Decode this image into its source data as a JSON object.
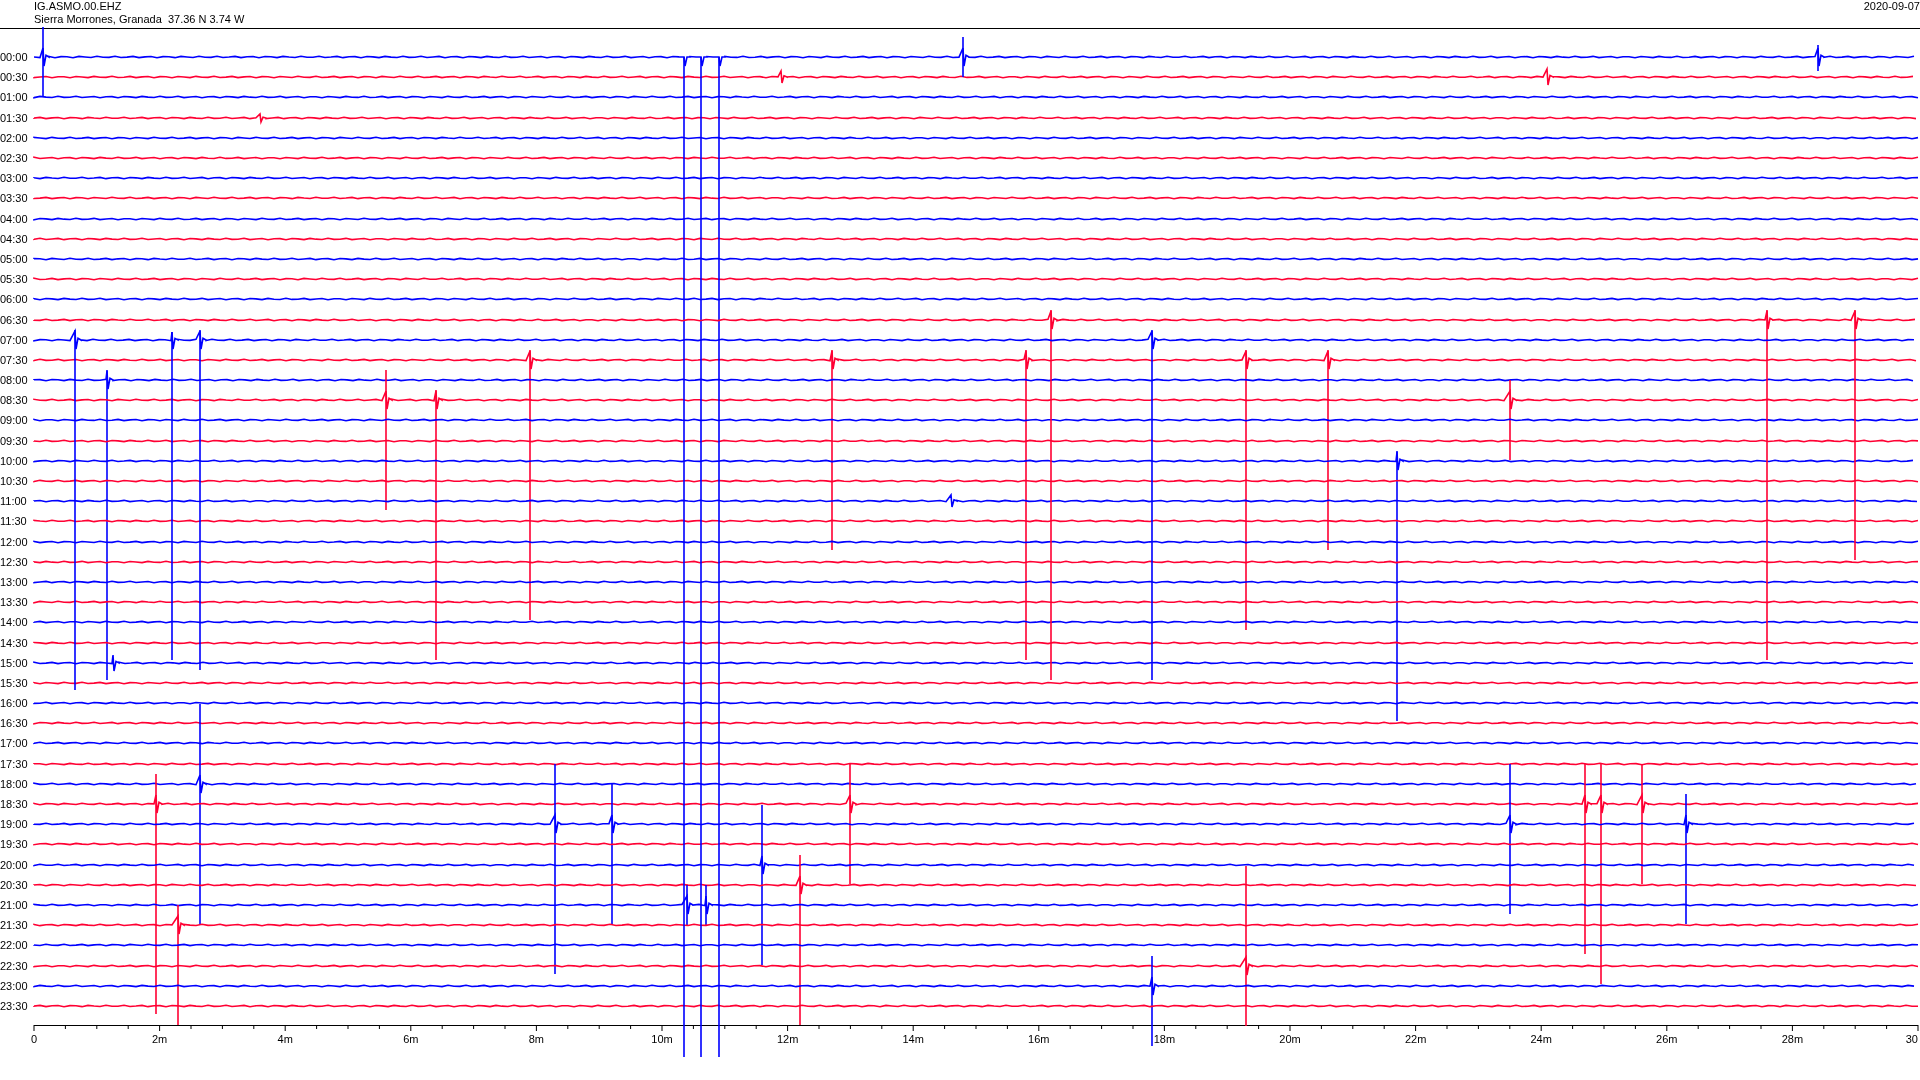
{
  "header": {
    "station": "IG.ASMO.00.EHZ",
    "location": "Sierra Morrones, Granada  37.36 N 3.74 W",
    "date": "2020-09-07"
  },
  "traces": [
    {
      "label": "00:00",
      "color": "#0000ff"
    },
    {
      "label": "00:30",
      "color": "#ff0033"
    },
    {
      "label": "01:00",
      "color": "#0000ff"
    },
    {
      "label": "01:30",
      "color": "#ff0033"
    },
    {
      "label": "02:00",
      "color": "#0000ff"
    },
    {
      "label": "02:30",
      "color": "#ff0033"
    },
    {
      "label": "03:00",
      "color": "#0000ff"
    },
    {
      "label": "03:30",
      "color": "#ff0033"
    },
    {
      "label": "04:00",
      "color": "#0000ff"
    },
    {
      "label": "04:30",
      "color": "#ff0033"
    },
    {
      "label": "05:00",
      "color": "#0000ff"
    },
    {
      "label": "05:30",
      "color": "#ff0033"
    },
    {
      "label": "06:00",
      "color": "#0000ff"
    },
    {
      "label": "06:30",
      "color": "#ff0033"
    },
    {
      "label": "07:00",
      "color": "#0000ff"
    },
    {
      "label": "07:30",
      "color": "#ff0033"
    },
    {
      "label": "08:00",
      "color": "#0000ff"
    },
    {
      "label": "08:30",
      "color": "#ff0033"
    },
    {
      "label": "09:00",
      "color": "#0000ff"
    },
    {
      "label": "09:30",
      "color": "#ff0033"
    },
    {
      "label": "10:00",
      "color": "#0000ff"
    },
    {
      "label": "10:30",
      "color": "#ff0033"
    },
    {
      "label": "11:00",
      "color": "#0000ff"
    },
    {
      "label": "11:30",
      "color": "#ff0033"
    },
    {
      "label": "12:00",
      "color": "#0000ff"
    },
    {
      "label": "12:30",
      "color": "#ff0033"
    },
    {
      "label": "13:00",
      "color": "#0000ff"
    },
    {
      "label": "13:30",
      "color": "#ff0033"
    },
    {
      "label": "14:00",
      "color": "#0000ff"
    },
    {
      "label": "14:30",
      "color": "#ff0033"
    },
    {
      "label": "15:00",
      "color": "#0000ff"
    },
    {
      "label": "15:30",
      "color": "#ff0033"
    },
    {
      "label": "16:00",
      "color": "#0000ff"
    },
    {
      "label": "16:30",
      "color": "#ff0033"
    },
    {
      "label": "17:00",
      "color": "#0000ff"
    },
    {
      "label": "17:30",
      "color": "#ff0033"
    },
    {
      "label": "18:00",
      "color": "#0000ff"
    },
    {
      "label": "18:30",
      "color": "#ff0033"
    },
    {
      "label": "19:00",
      "color": "#0000ff"
    },
    {
      "label": "19:30",
      "color": "#ff0033"
    },
    {
      "label": "20:00",
      "color": "#0000ff"
    },
    {
      "label": "20:30",
      "color": "#ff0033"
    },
    {
      "label": "21:00",
      "color": "#0000ff"
    },
    {
      "label": "21:30",
      "color": "#ff0033"
    },
    {
      "label": "22:00",
      "color": "#0000ff"
    },
    {
      "label": "22:30",
      "color": "#ff0033"
    },
    {
      "label": "23:00",
      "color": "#0000ff"
    },
    {
      "label": "23:30",
      "color": "#ff0033"
    }
  ],
  "x_axis": {
    "labels": [
      "0",
      "2m",
      "4m",
      "6m",
      "8m",
      "10m",
      "12m",
      "14m",
      "16m",
      "18m",
      "20m",
      "22m",
      "24m",
      "26m",
      "28m",
      "30"
    ]
  }
}
